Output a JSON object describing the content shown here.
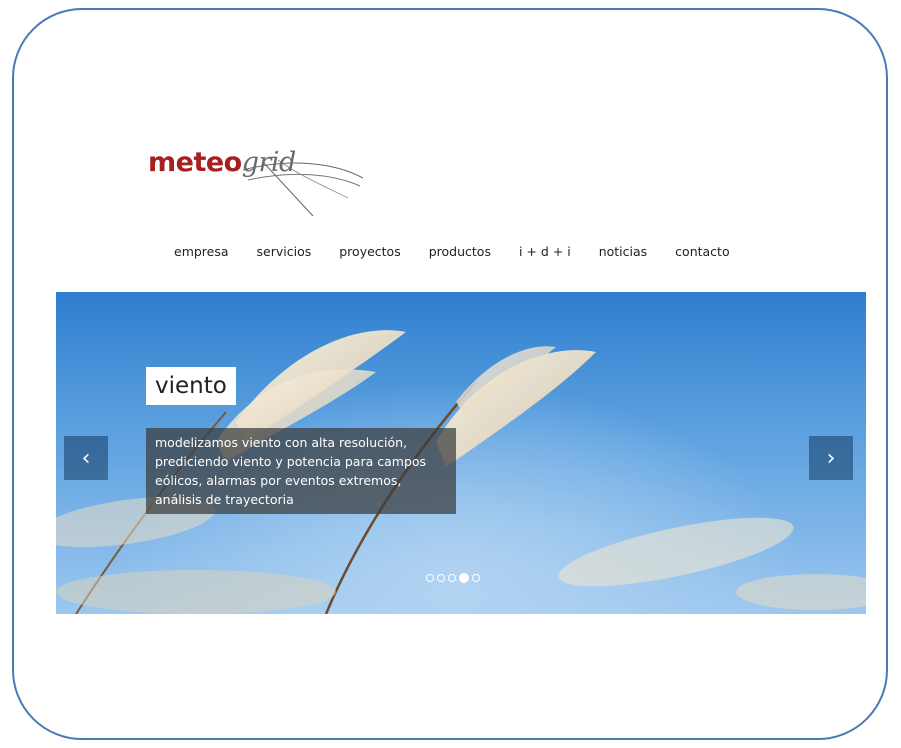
{
  "logo": {
    "part1": "meteo",
    "part2": "grid"
  },
  "nav": {
    "items": [
      {
        "label": "empresa"
      },
      {
        "label": "servicios"
      },
      {
        "label": "proyectos"
      },
      {
        "label": "productos"
      },
      {
        "label": "i + d + i"
      },
      {
        "label": "noticias"
      },
      {
        "label": "contacto"
      }
    ]
  },
  "slider": {
    "title": "viento",
    "description": "modelizamos viento con alta resolución, prediciendo viento y potencia para campos eólicos, alarmas por eventos extremos, análisis de trayectoria",
    "prev_icon": "chevron-left-icon",
    "next_icon": "chevron-right-icon",
    "prev_glyph": "‹",
    "next_glyph": "›",
    "dots_total": 5,
    "active_dot": 4
  },
  "colors": {
    "frame_border": "#4a7bb7",
    "brand_red": "#a81f1f",
    "sky_blue": "#2f7fcf"
  }
}
